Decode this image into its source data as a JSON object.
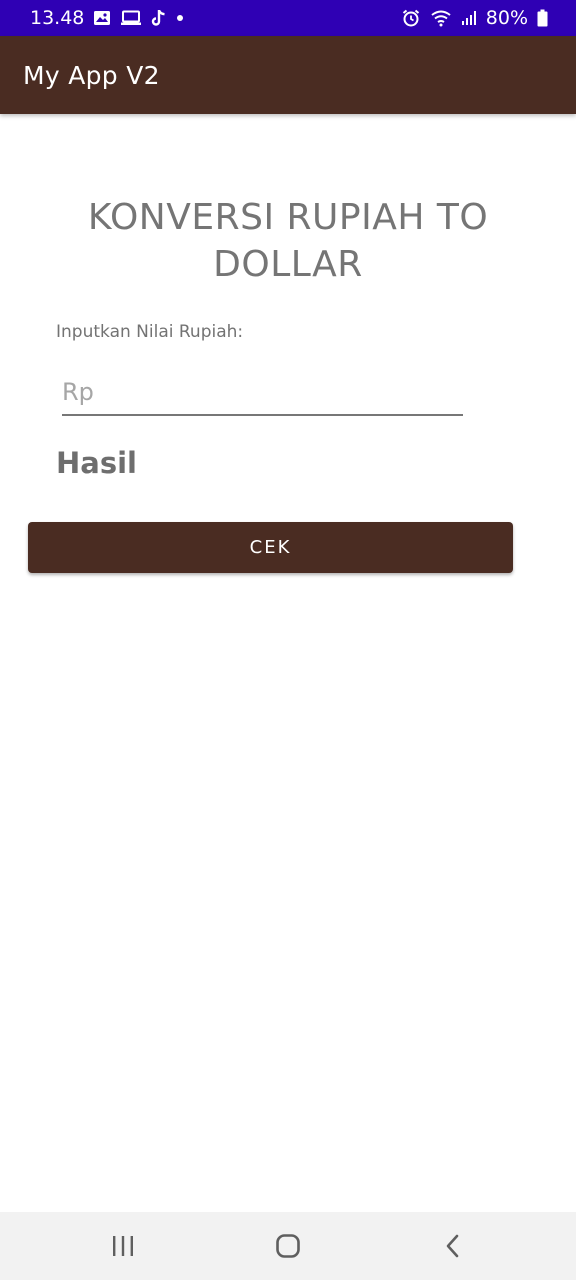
{
  "status_bar": {
    "time": "13.48",
    "battery": "80%",
    "left_icons": [
      "gallery-icon",
      "laptop-icon",
      "tiktok-icon",
      "dot-icon"
    ],
    "right_icons": [
      "alarm-icon",
      "wifi-icon",
      "signal-icon",
      "battery-icon"
    ]
  },
  "app_bar": {
    "title": "My App V2"
  },
  "main": {
    "heading": "KONVERSI RUPIAH TO DOLLAR",
    "input_label": "Inputkan Nilai Rupiah:",
    "input_placeholder": "Rp",
    "input_value": "",
    "result_label": "Hasil",
    "button_label": "CEK"
  },
  "nav_bar": {
    "buttons": [
      "recent-apps-icon",
      "home-icon",
      "back-icon"
    ]
  },
  "colors": {
    "status_bar": "#2f00b4",
    "app_bar": "#4a2c22",
    "button": "#4a2c22",
    "nav_bar": "#f2f2f2"
  }
}
